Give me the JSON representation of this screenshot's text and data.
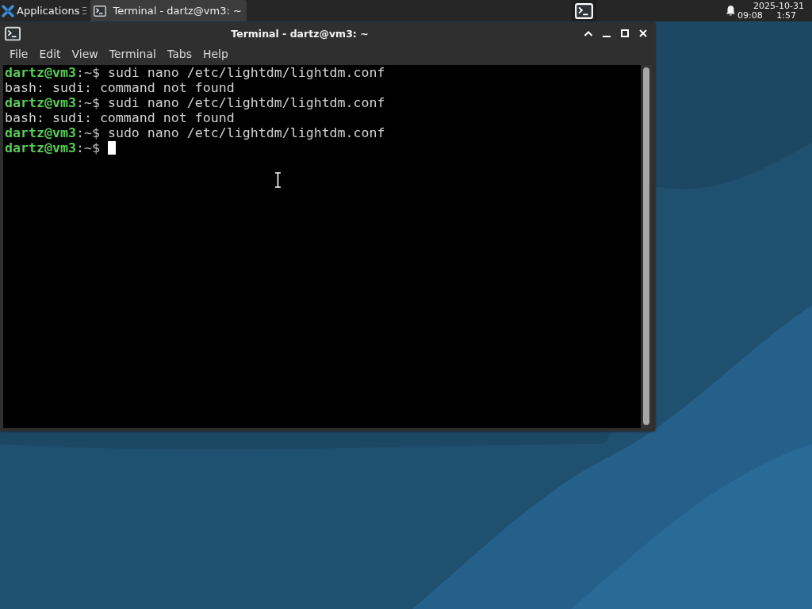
{
  "panel": {
    "applications_button": {
      "label": "Applications"
    },
    "tasks": [
      {
        "label": "Terminal - dartz@vm3: ~",
        "selected": true
      }
    ],
    "clock": {
      "date": "2025-10-31",
      "time": "09:08",
      "time_extra": "1:57"
    }
  },
  "window": {
    "title": "Terminal - dartz@vm3: ~",
    "menu": [
      "File",
      "Edit",
      "View",
      "Terminal",
      "Tabs",
      "Help"
    ],
    "lines": [
      {
        "kind": "prompt",
        "user": "dartz@vm3",
        "path": ":~$",
        "command": "sudi nano /etc/lightdm/lightdm.conf",
        "cursor": false
      },
      {
        "kind": "output",
        "text": "bash: sudi: command not found"
      },
      {
        "kind": "prompt",
        "user": "dartz@vm3",
        "path": ":~$",
        "command": "sudi nano /etc/lightdm/lightdm.conf",
        "cursor": false
      },
      {
        "kind": "output",
        "text": "bash: sudi: command not found"
      },
      {
        "kind": "prompt",
        "user": "dartz@vm3",
        "path": ":~$",
        "command": "sudo nano /etc/lightdm/lightdm.conf",
        "cursor": false
      },
      {
        "kind": "prompt",
        "user": "dartz@vm3",
        "path": ":~$",
        "cursor": true
      }
    ]
  }
}
